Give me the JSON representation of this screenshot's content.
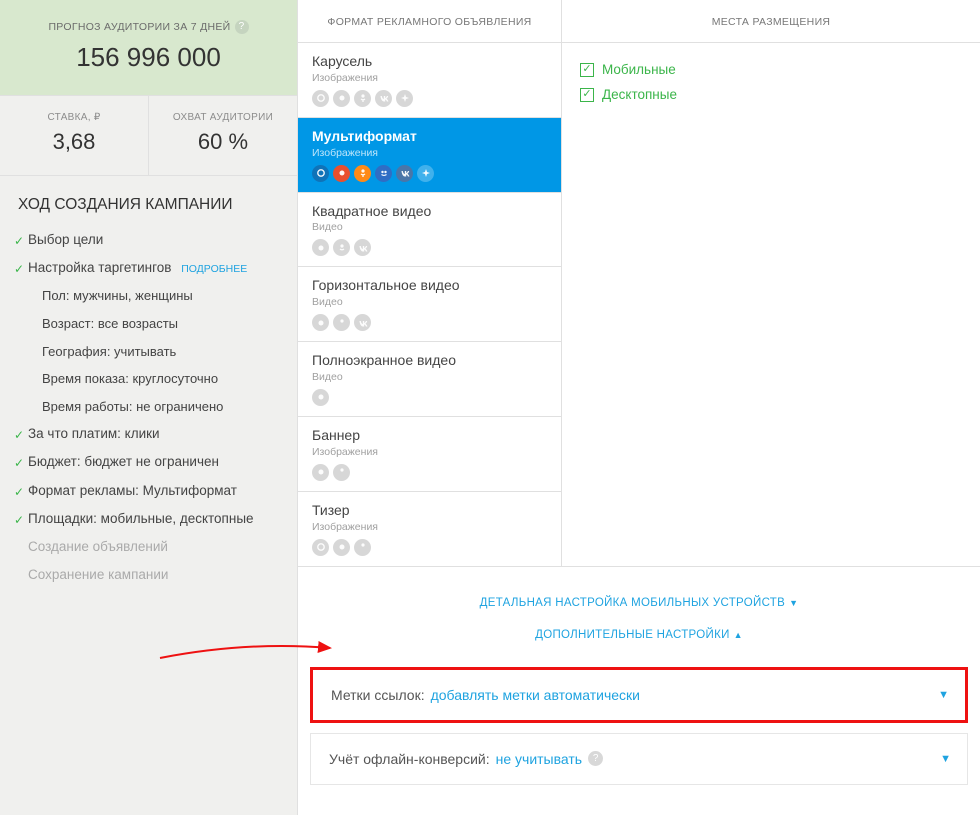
{
  "prognosis": {
    "label": "ПРОГНОЗ АУДИТОРИИ ЗА 7 ДНЕЙ",
    "value": "156 996 000"
  },
  "stats": {
    "stake_label": "СТАВКА, ₽",
    "stake_value": "3,68",
    "reach_label": "ОХВАТ АУДИТОРИИ",
    "reach_value": "60 %"
  },
  "progress": {
    "title": "ХОД СОЗДАНИЯ КАМПАНИИ",
    "more_label": "ПОДРОБНЕЕ",
    "steps": {
      "goal": "Выбор цели",
      "targeting": "Настройка таргетингов",
      "sub_gender": "Пол: мужчины, женщины",
      "sub_age": "Возраст: все возрасты",
      "sub_geo": "География: учитывать",
      "sub_time": "Время показа: круглосуточно",
      "sub_duration": "Время работы: не ограничено",
      "pay": "За что платим: клики",
      "budget": "Бюджет: бюджет не ограничен",
      "format": "Формат рекламы: Мультиформат",
      "placements": "Площадки: мобильные, десктопные",
      "create_ads": "Создание объявлений",
      "save_campaign": "Сохранение кампании"
    }
  },
  "format_col_header": "ФОРМАТ РЕКЛАМНОГО ОБЪЯВЛЕНИЯ",
  "placement_col_header": "МЕСТА РАЗМЕЩЕНИЯ",
  "formats": {
    "carousel": {
      "title": "Карусель",
      "sub": "Изображения"
    },
    "multi": {
      "title": "Мультиформат",
      "sub": "Изображения"
    },
    "sq_video": {
      "title": "Квадратное видео",
      "sub": "Видео"
    },
    "hz_video": {
      "title": "Горизонтальное видео",
      "sub": "Видео"
    },
    "fs_video": {
      "title": "Полноэкранное видео",
      "sub": "Видео"
    },
    "banner": {
      "title": "Баннер",
      "sub": "Изображения"
    },
    "teaser": {
      "title": "Тизер",
      "sub": "Изображения"
    }
  },
  "placements": {
    "mobile": "Мобильные",
    "desktop": "Десктопные"
  },
  "expanders": {
    "mobile_detail": "ДЕТАЛЬНАЯ НАСТРОЙКА МОБИЛЬНЫХ УСТРОЙСТВ",
    "more_settings": "ДОПОЛНИТЕЛЬНЫЕ НАСТРОЙКИ"
  },
  "panels": {
    "link_tags_label": "Метки ссылок:",
    "link_tags_value": "добавлять метки автоматически",
    "offline_label": "Учёт офлайн-конверсий:",
    "offline_value": "не учитывать"
  }
}
